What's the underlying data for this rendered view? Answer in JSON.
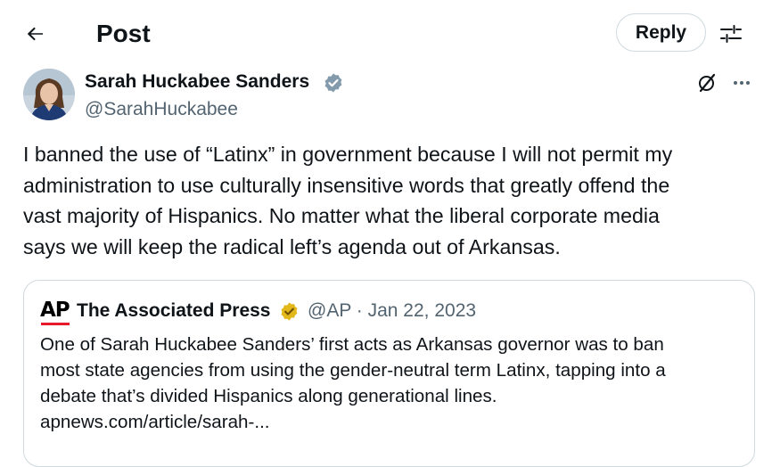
{
  "header": {
    "title": "Post",
    "reply_label": "Reply",
    "back_icon": "arrow-left-icon",
    "filter_icon": "sliders-icon"
  },
  "author": {
    "name": "Sarah Huckabee Sanders",
    "handle": "@SarahHuckabee",
    "verified_color": "#829aab"
  },
  "post": {
    "text": "I banned the use of “Latinx” in government because I will not permit my\nadministration to use culturally insensitive words that greatly offend the\nvast majority of Hispanics. No matter what the liberal corporate media\nsays we will keep the radical left’s agenda out of Arkansas."
  },
  "quote": {
    "logo": "AP",
    "name": "The Associated Press",
    "meta": "@AP · Jan 22, 2023",
    "text": "One of Sarah Huckabee Sanders’ first acts as Arkansas governor was to ban\nmost state agencies from using the gender-neutral term Latinx, tapping into a\ndebate that’s divided Hispanics along generational lines.\napnews.com/article/sarah-...",
    "badge_color": "#e2b719"
  },
  "colors": {
    "text": "#0f1419",
    "secondary": "#536471",
    "border": "#cfd9de",
    "ap_red": "#e8192c"
  }
}
